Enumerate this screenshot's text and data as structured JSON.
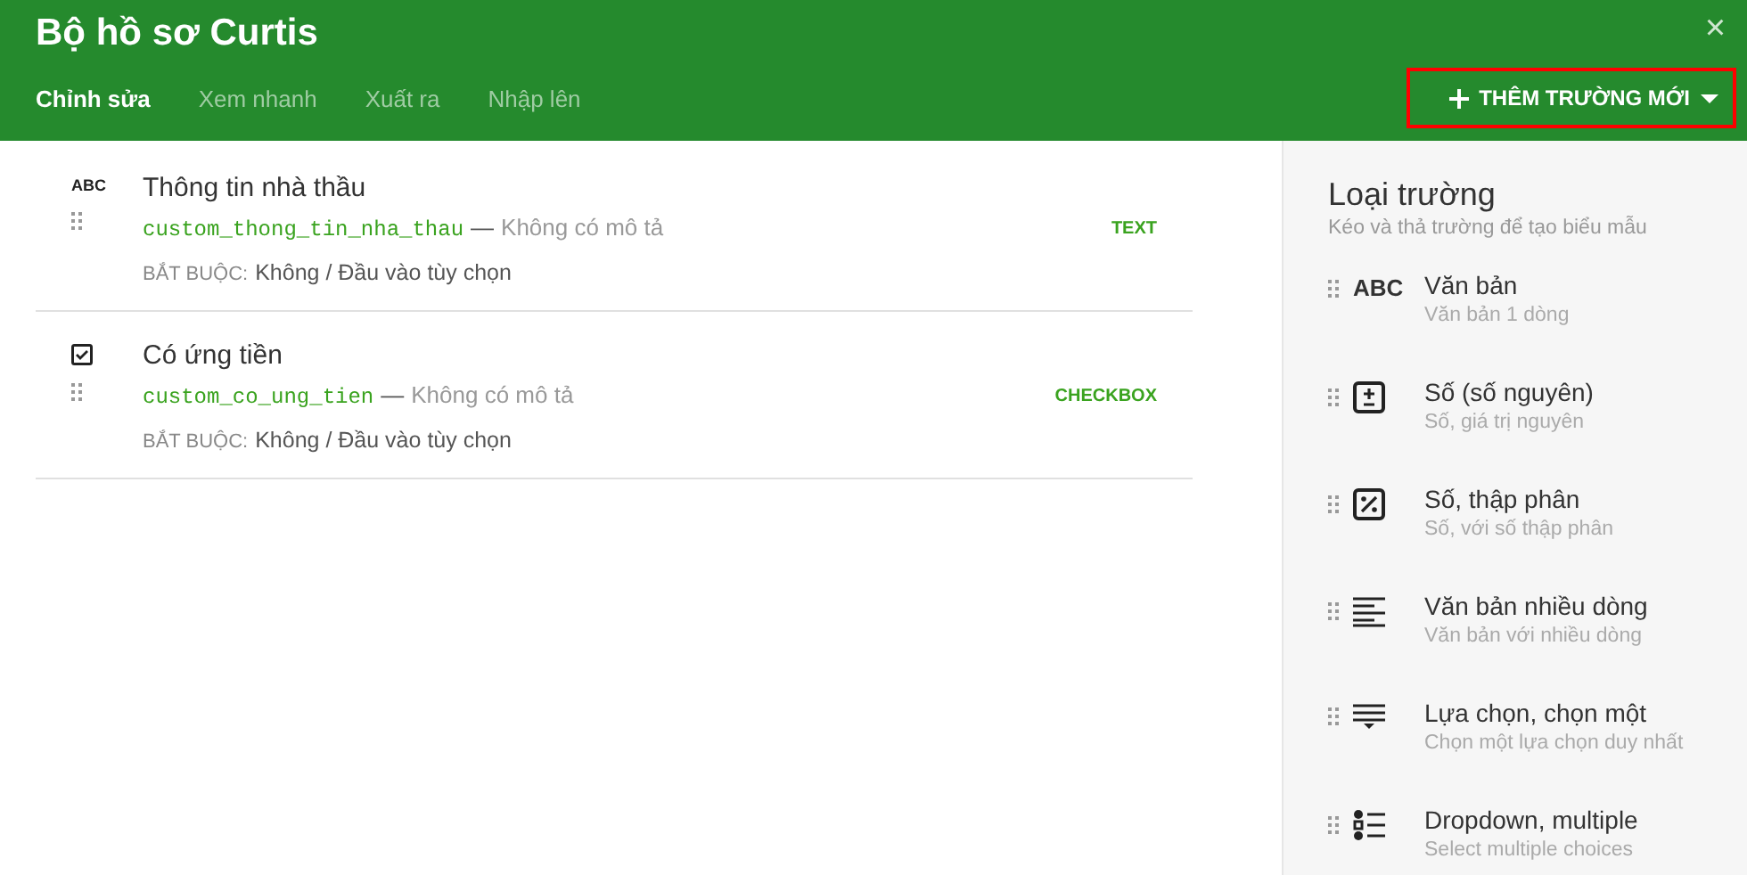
{
  "window": {
    "title": "Bộ hồ sơ Curtis",
    "close": "×"
  },
  "tabs": [
    {
      "label": "Chỉnh sửa",
      "selected": true
    },
    {
      "label": "Xem nhanh",
      "selected": false
    },
    {
      "label": "Xuất ra",
      "selected": false
    },
    {
      "label": "Nhập lên",
      "selected": false
    }
  ],
  "add_button": {
    "label": "THÊM TRƯỜNG MỚI",
    "highlighted": true
  },
  "fields": [
    {
      "kind": "text",
      "icon_label": "ABC",
      "title": "Thông tin nhà thầu",
      "key": "custom_thong_tin_nha_thau",
      "separator": "—",
      "description": "Không có mô tả",
      "required_label": "BẮT BUỘC:",
      "required_value": "Không / Đầu vào tùy chọn",
      "type": "TEXT"
    },
    {
      "kind": "checkbox",
      "title": "Có ứng tiền",
      "key": "custom_co_ung_tien",
      "separator": "—",
      "description": "Không có mô tả",
      "required_label": "BẮT BUỘC:",
      "required_value": "Không / Đầu vào tùy chọn",
      "type": "CHECKBOX"
    }
  ],
  "panel": {
    "title": "Loại trường",
    "subtitle": "Kéo và thả trường để tạo biểu mẫu",
    "items": [
      {
        "kind": "text",
        "icon_label": "ABC",
        "name": "Văn bản",
        "hint": "Văn bản 1 dòng"
      },
      {
        "kind": "integer",
        "name": "Số (số nguyên)",
        "hint": "Số, giá trị nguyên"
      },
      {
        "kind": "decimal",
        "name": "Số, thập phân",
        "hint": "Số, với số thập phân"
      },
      {
        "kind": "multiline",
        "name": "Văn bản nhiều dòng",
        "hint": "Văn bản với nhiều dòng"
      },
      {
        "kind": "select",
        "name": "Lựa chọn, chọn một",
        "hint": "Chọn một lựa chọn duy nhất"
      },
      {
        "kind": "multiple",
        "name": "Dropdown, multiple",
        "hint": "Select multiple choices"
      }
    ]
  }
}
